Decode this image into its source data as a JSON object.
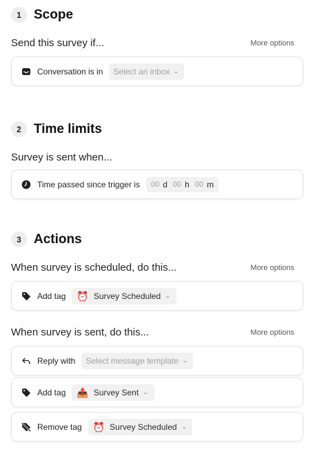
{
  "scope": {
    "number": "1",
    "title": "Scope",
    "subheading": "Send this survey if...",
    "more_options": "More options",
    "condition_label": "Conversation is in",
    "inbox_placeholder": "Select an inbox"
  },
  "time_limits": {
    "number": "2",
    "title": "Time limits",
    "subheading": "Survey is sent when...",
    "condition_label": "Time passed since trigger is",
    "days_value": "00",
    "days_unit": "d",
    "hours_value": "00",
    "hours_unit": "h",
    "minutes_value": "00",
    "minutes_unit": "m"
  },
  "actions": {
    "number": "3",
    "title": "Actions",
    "scheduled": {
      "subheading": "When survey is scheduled, do this...",
      "more_options": "More options",
      "add_tag_label": "Add tag",
      "tag_emoji": "⏰",
      "tag_name": "Survey Scheduled"
    },
    "sent": {
      "subheading": "When survey is sent, do this...",
      "more_options": "More options",
      "reply_label": "Reply with",
      "template_placeholder": "Select message template",
      "add_tag_label": "Add tag",
      "add_tag_emoji": "📤",
      "add_tag_name": "Survey Sent",
      "remove_tag_label": "Remove tag",
      "remove_tag_emoji": "⏰",
      "remove_tag_name": "Survey Scheduled"
    }
  },
  "icons": {
    "inbox": "inbox-icon",
    "clock": "clock-icon",
    "tag": "tag-icon",
    "reply": "reply-arrow-icon",
    "tag_off": "tag-off-icon",
    "chevron": "chevron-down-icon"
  },
  "colors": {
    "icon_dark": "#1f1f1f",
    "select_bg": "#f1f1f1",
    "badge_bg": "#ededed",
    "card_border": "#e4e4e4"
  }
}
